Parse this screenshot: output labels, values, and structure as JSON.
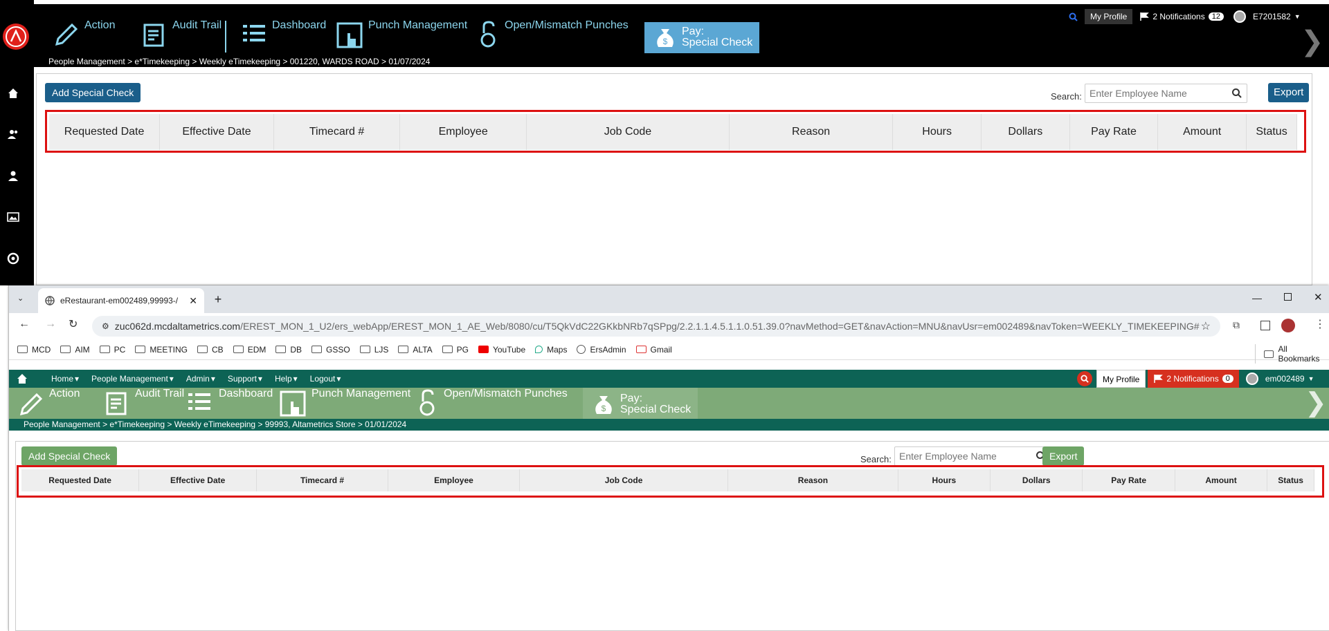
{
  "back": {
    "status": {
      "my_profile": "My Profile",
      "notifications_label": "2 Notifications",
      "notifications_count": "12",
      "user": "E7201582"
    },
    "toolbar": [
      {
        "label": "Action",
        "icon": "pencil-icon"
      },
      {
        "label": "Audit Trail",
        "icon": "clipboard-icon"
      },
      {
        "label": "Dashboard",
        "icon": "list-icon"
      },
      {
        "label": "Punch Management",
        "icon": "hand-cursor-icon"
      },
      {
        "label": "Open/Mismatch Punches",
        "icon": "open-lock-icon"
      },
      {
        "label_line1": "Pay:",
        "label_line2": "Special Check",
        "icon": "money-bag-icon",
        "active": true
      }
    ],
    "breadcrumb": "People Management > e*Timekeeping > Weekly eTimekeeping  > 001220, WARDS ROAD > 01/07/2024",
    "add_button": "Add Special Check",
    "search_label": "Search:",
    "search_placeholder": "Enter Employee Name",
    "export_button": "Export",
    "columns": [
      "Requested Date",
      "Effective Date",
      "Timecard #",
      "Employee",
      "Job Code",
      "Reason",
      "Hours",
      "Dollars",
      "Pay Rate",
      "Amount",
      "Status"
    ],
    "colors": {
      "toolbar_bg": "#000000",
      "accent": "#5ba7d4",
      "button": "#1a5e8a",
      "highlight": "#dd1111"
    }
  },
  "browser": {
    "tab_title": "eRestaurant-em002489,99993-/",
    "url_domain": "zuc062d.mcdaltametrics.com",
    "url_path": "/EREST_MON_1_U2/ers_webApp/EREST_MON_1_AE_Web/8080/cu/T5QkVdC22GKkbNRb7qSPpg/2.2.1.1.4.5.1.1.0.51.39.0?navMethod=GET&navAction=MNU&navUsr=em002489&navToken=WEEKLY_TIMEKEEPING#",
    "bookmarks": [
      "MCD",
      "AIM",
      "PC",
      "MEETING",
      "CB",
      "EDM",
      "DB",
      "GSSO",
      "LJS",
      "ALTA",
      "PG",
      "YouTube",
      "Maps",
      "ErsAdmin",
      "Gmail"
    ],
    "all_bookmarks": "All Bookmarks"
  },
  "front": {
    "menu": [
      "Home",
      "People Management",
      "Admin",
      "Support",
      "Help",
      "Logout"
    ],
    "status": {
      "my_profile": "My Profile",
      "notifications_label": "2 Notifications",
      "notifications_count": "0",
      "user": "em002489"
    },
    "toolbar": [
      {
        "label": "Action",
        "icon": "pencil-icon"
      },
      {
        "label": "Audit Trail",
        "icon": "clipboard-icon"
      },
      {
        "label": "Dashboard",
        "icon": "list-icon"
      },
      {
        "label": "Punch Management",
        "icon": "hand-cursor-icon"
      },
      {
        "label": "Open/Mismatch Punches",
        "icon": "open-lock-icon"
      },
      {
        "label_line1": "Pay:",
        "label_line2": "Special Check",
        "icon": "money-bag-icon",
        "active": true
      }
    ],
    "breadcrumb": "People Management > e*Timekeeping > Weekly eTimekeeping  > 99993, Altametrics Store > 01/01/2024",
    "add_button": "Add Special Check",
    "search_label": "Search:",
    "search_placeholder": "Enter Employee Name",
    "export_button": "Export",
    "columns": [
      "Requested Date",
      "Effective Date",
      "Timecard #",
      "Employee",
      "Job Code",
      "Reason",
      "Hours",
      "Dollars",
      "Pay Rate",
      "Amount",
      "Status"
    ],
    "colors": {
      "nav_bg": "#0d6355",
      "toolbar_bg": "#7eaa78",
      "button": "#6ea566",
      "notif_bg": "#d6301f",
      "highlight": "#dd1111"
    }
  }
}
